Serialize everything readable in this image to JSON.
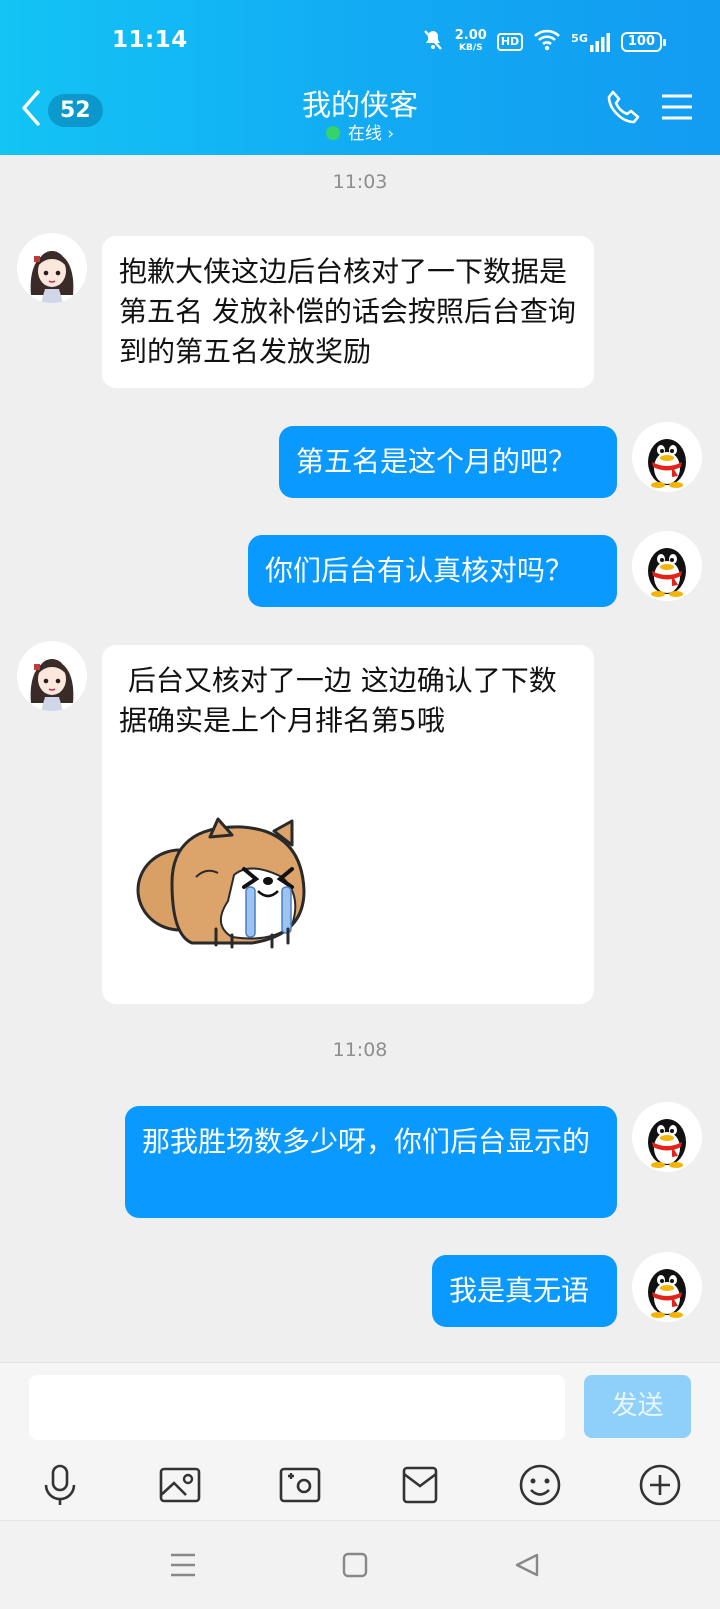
{
  "status_bar": {
    "time": "11:14",
    "net_speed_value": "2.00",
    "net_speed_unit": "KB/S",
    "hd": "HD",
    "signal": "5G",
    "battery": "100"
  },
  "header": {
    "unread_count": "52",
    "title": "我的侠客",
    "subtitle": "在线 ›"
  },
  "messages": [
    {
      "type": "timestamp",
      "text": "11:03"
    },
    {
      "type": "incoming",
      "text": "抱歉大侠这边后台核对了一下数据是第五名 发放补偿的话会按照后台查询到的第五名发放奖励"
    },
    {
      "type": "outgoing",
      "text": "第五名是这个月的吧？"
    },
    {
      "type": "outgoing",
      "text": "你们后台有认真核对吗？"
    },
    {
      "type": "incoming",
      "text": " 后台又核对了一边 这边确认了下数据确实是上个月排名第5哦",
      "sticker": "crying-shiba-sticker"
    },
    {
      "type": "timestamp",
      "text": "11:08"
    },
    {
      "type": "outgoing",
      "text": "那我胜场数多少呀，你们后台显示的"
    },
    {
      "type": "outgoing",
      "text": "我是真无语"
    }
  ],
  "input": {
    "placeholder": "",
    "send_label": "发送"
  },
  "toolbar": [
    "mic-icon",
    "image-icon",
    "camera-icon",
    "gift-icon",
    "emoji-icon",
    "plus-icon"
  ],
  "colors": {
    "header_start": "#13c4f5",
    "header_end": "#129cf2",
    "outgoing_bubble": "#0a99ff",
    "incoming_bubble": "#ffffff",
    "send_disabled": "#8fd0fb",
    "online": "#35d36a"
  }
}
